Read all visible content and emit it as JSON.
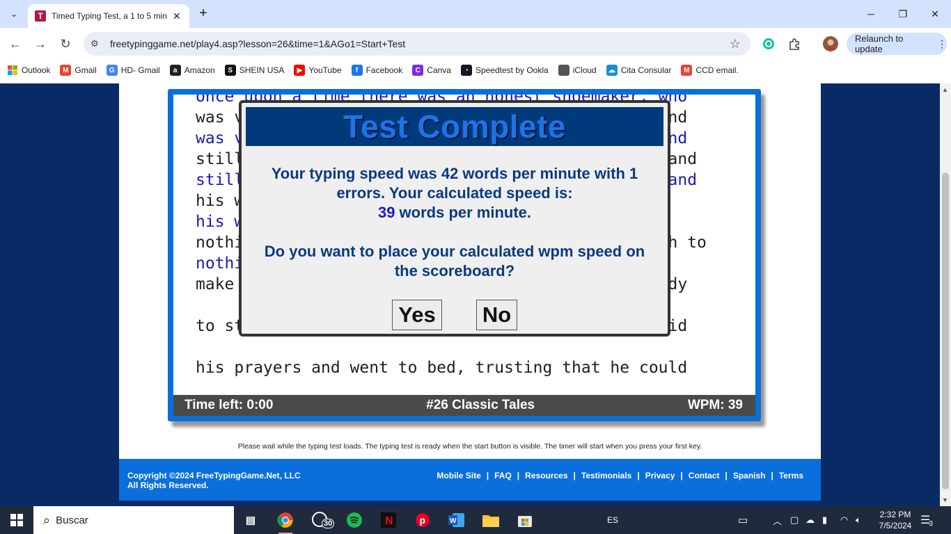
{
  "browser": {
    "tab_title": "Timed Typing Test, a 1 to 5 min",
    "tab_favicon_letter": "T",
    "url": "freetypinggame.net/play4.asp?lesson=26&time=1&AGo1=Start+Test",
    "relaunch_label": "Relaunch to update",
    "bookmarks": [
      {
        "label": "Outlook",
        "icon": "ms-icon",
        "color": "#0078d4"
      },
      {
        "label": "Gmail",
        "icon": "M",
        "color": "#ea4335"
      },
      {
        "label": "HD- Gmail",
        "icon": "G",
        "color": "#4285f4"
      },
      {
        "label": "Amazon",
        "icon": "a",
        "color": "#222222"
      },
      {
        "label": "SHEIN USA",
        "icon": "S",
        "color": "#111111"
      },
      {
        "label": "YouTube",
        "icon": "▶",
        "color": "#ff0000"
      },
      {
        "label": "Facebook",
        "icon": "f",
        "color": "#1877f2"
      },
      {
        "label": "Canva",
        "icon": "C",
        "color": "#7d2ae8"
      },
      {
        "label": "Speedtest by Ookla",
        "icon": "◔",
        "color": "#141526"
      },
      {
        "label": "iCloud",
        "icon": "",
        "color": "#555555"
      },
      {
        "label": "Cita Consular",
        "icon": "☁",
        "color": "#1a8fd6"
      },
      {
        "label": "CCD email.",
        "icon": "M",
        "color": "#ea4335"
      }
    ]
  },
  "typing_test": {
    "lines": [
      {
        "text": "once upon a time there was an honest shoemaker, who",
        "kind": "typed"
      },
      {
        "text": "was v                                            nd",
        "kind": "orig"
      },
      {
        "text": "was v                                            nd",
        "kind": "typed"
      },
      {
        "text": "still                                            and",
        "kind": "orig"
      },
      {
        "text": "still                                            and",
        "kind": "typed"
      },
      {
        "text": "his w",
        "kind": "orig"
      },
      {
        "text": "his w",
        "kind": "typed"
      },
      {
        "text": "nothi                                           gh to",
        "kind": "orig"
      },
      {
        "text": "nothi",
        "kind": "typed"
      },
      {
        "text": "make                                           eady",
        "kind": "orig"
      },
      {
        "text": "to st                                          said",
        "kind": "orig"
      },
      {
        "text": "his prayers and went to bed, trusting that he could",
        "kind": "orig"
      }
    ],
    "status": {
      "time_left": "Time left: 0:00",
      "lesson": "#26 Classic Tales",
      "wpm": "WPM: 39"
    },
    "loading_note": "Please wait while the typing test loads. The typing test is ready when the start button is visible. The timer will start when you press your first key."
  },
  "modal": {
    "title": "Test Complete",
    "line1": "Your typing speed was 42 words per minute with 1",
    "line2": "errors. Your calculated speed is:",
    "calc_speed": "39",
    "line3_suffix": " words per minute.",
    "question_1": "Do you want to place your calculated wpm speed on",
    "question_2": "the scoreboard?",
    "yes_label": "Yes",
    "no_label": "No"
  },
  "footer": {
    "copyright_1": "Copyright ©2024 FreeTypingGame.Net, LLC",
    "copyright_2": "All Rights Reserved.",
    "links": [
      "Mobile Site",
      "FAQ",
      "Resources",
      "Testimonials",
      "Privacy",
      "Contact",
      "Spanish",
      "Terms"
    ]
  },
  "taskbar": {
    "search_placeholder": "Buscar",
    "whatsapp_badge": "30",
    "language": "ES",
    "time": "2:32 PM",
    "date": "7/5/2024",
    "notification_count": "3"
  }
}
